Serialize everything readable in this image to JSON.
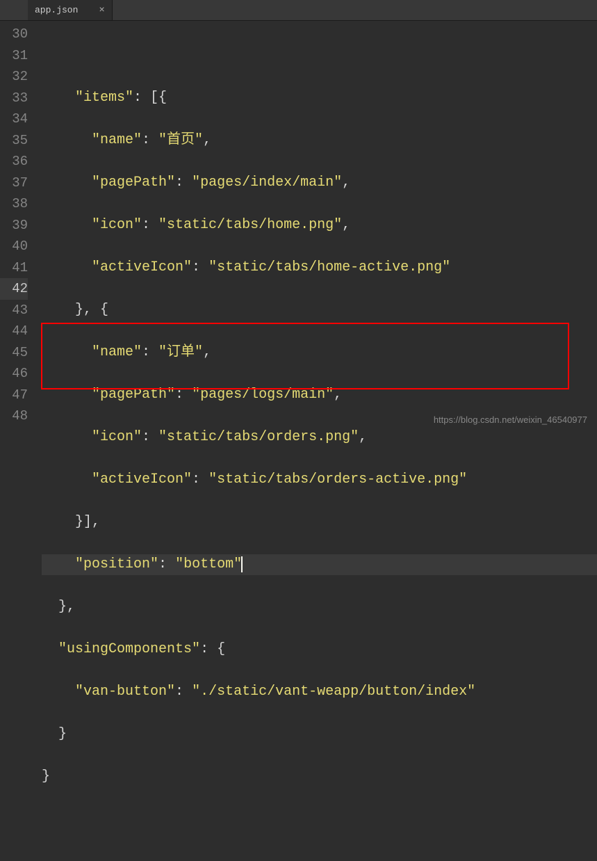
{
  "tab": {
    "filename": "app.json",
    "close": "×"
  },
  "gutter": [
    "30",
    "31",
    "32",
    "33",
    "34",
    "35",
    "36",
    "37",
    "38",
    "39",
    "40",
    "41",
    "42",
    "43",
    "44",
    "45",
    "46",
    "47",
    "48"
  ],
  "activeLine": "42",
  "code": {
    "k_items": "\"items\"",
    "k_name": "\"name\"",
    "k_pagePath": "\"pagePath\"",
    "k_icon": "\"icon\"",
    "k_activeIcon": "\"activeIcon\"",
    "k_position": "\"position\"",
    "k_usingComponents": "\"usingComponents\"",
    "k_vanButton": "\"van-button\"",
    "v_home": "\"首页\"",
    "v_indexMain": "\"pages/index/main\"",
    "v_homePng": "\"static/tabs/home.png\"",
    "v_homeActive": "\"static/tabs/home-active.png\"",
    "v_orders": "\"订单\"",
    "v_logsMain": "\"pages/logs/main\"",
    "v_ordersPng": "\"static/tabs/orders.png\"",
    "v_ordersActive": "\"static/tabs/orders-active.png\"",
    "v_bottom": "\"bottom\"",
    "v_vanButtonPath": "\"./static/vant-weapp/button/index\""
  },
  "watermark": "https://blog.csdn.net/weixin_46540977"
}
